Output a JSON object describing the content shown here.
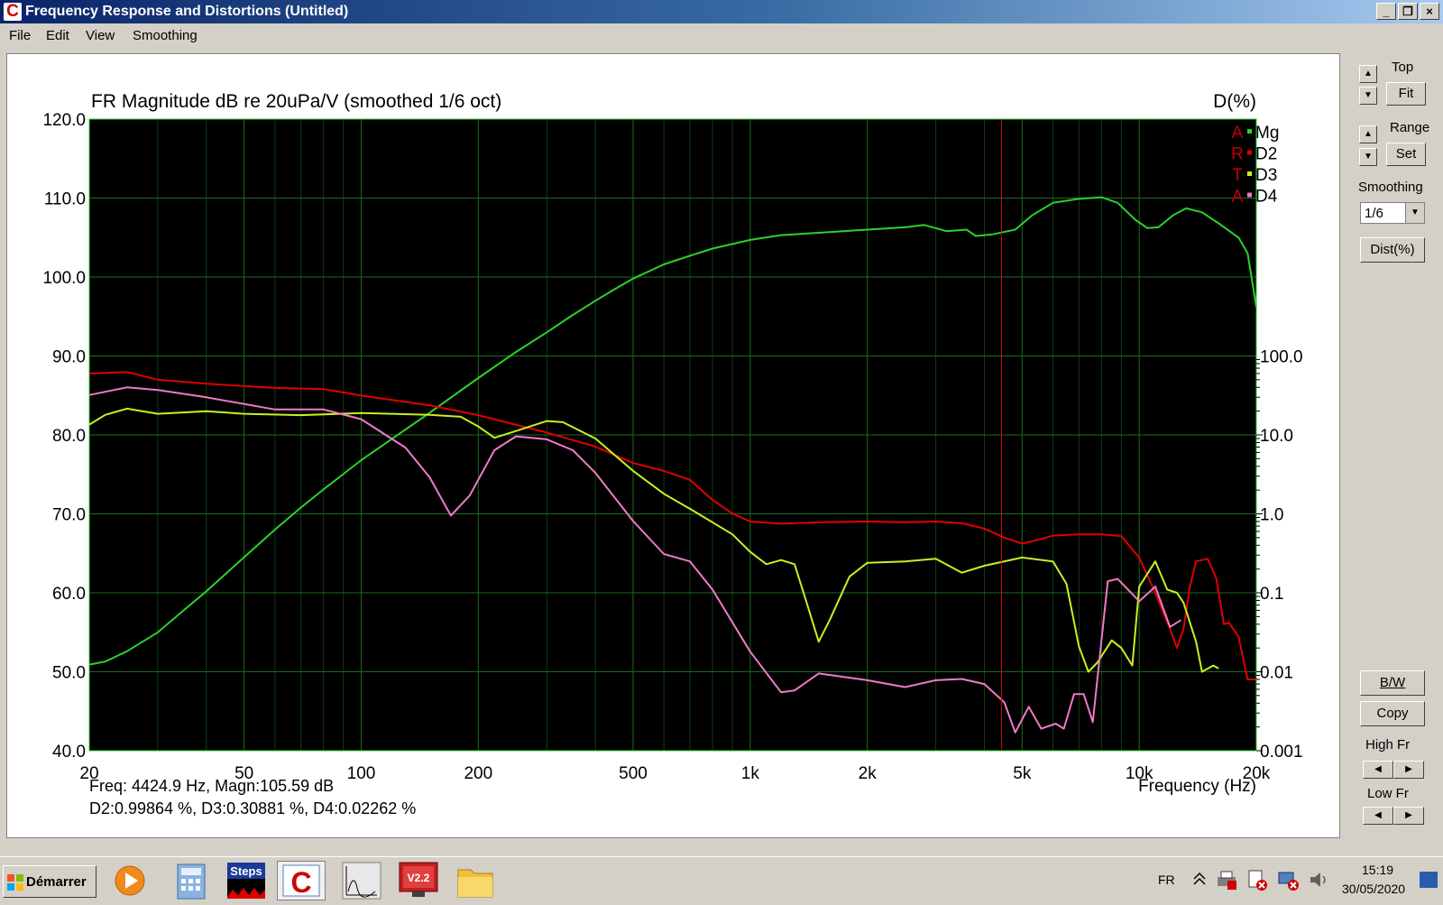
{
  "window": {
    "title": "Frequency Response and Distortions (Untitled)",
    "app_icon_glyph": "C",
    "controls": {
      "minimize": "_",
      "restore": "❐",
      "close": "×"
    }
  },
  "menu": {
    "items": [
      "File",
      "Edit",
      "View",
      "Smoothing"
    ]
  },
  "graph": {
    "title": "FR Magnitude dB re 20uPa/V (smoothed 1/6 oct)",
    "right_axis_title": "D(%)",
    "xlabel": "Frequency (Hz)",
    "rta_letters": [
      "A",
      "R",
      "T",
      "A"
    ],
    "legend": [
      {
        "name": "Mg",
        "color": "#2cd12c"
      },
      {
        "name": "D2",
        "color": "#e00000"
      },
      {
        "name": "D3",
        "color": "#c8f020"
      },
      {
        "name": "D4",
        "color": "#f07ac8"
      }
    ],
    "readout_line1": "Freq: 4424.9 Hz, Magn:105.59 dB",
    "readout_line2": "D2:0.99864 %, D3:0.30881 %, D4:0.02262 %"
  },
  "chart_data": {
    "type": "line",
    "title": "FR Magnitude dB re 20uPa/V (smoothed 1/6 oct)",
    "xlabel": "Frequency (Hz)",
    "ylabel": "",
    "y2label": "D(%)",
    "x_scale": "log",
    "y2_scale": "log",
    "xlim": [
      20,
      20000
    ],
    "ylim": [
      40,
      120
    ],
    "y2lim": [
      0.001,
      100
    ],
    "x_ticks": [
      20,
      50,
      100,
      200,
      500,
      1000,
      2000,
      5000,
      10000,
      20000
    ],
    "x_tick_labels": [
      "20",
      "50",
      "100",
      "200",
      "500",
      "1k",
      "2k",
      "5k",
      "10k",
      "20k"
    ],
    "y_ticks": [
      40,
      50,
      60,
      70,
      80,
      90,
      100,
      110,
      120
    ],
    "y_tick_labels": [
      "40.0",
      "50.0",
      "60.0",
      "70.0",
      "80.0",
      "90.0",
      "100.0",
      "110.0",
      "120.0"
    ],
    "y2_ticks": [
      0.001,
      0.01,
      0.1,
      1,
      10,
      100
    ],
    "y2_tick_labels": [
      "0.001",
      "0.01",
      "0.1",
      "1.0",
      "10.0",
      "100.0"
    ],
    "grid": true,
    "legend_position": "top-right",
    "background": "#000000",
    "cursor_x": 4424.9,
    "series": [
      {
        "name": "Mg",
        "axis": "left",
        "color": "#2cd12c",
        "points": [
          [
            20,
            50.9
          ],
          [
            22,
            51.3
          ],
          [
            25,
            52.6
          ],
          [
            30,
            55
          ],
          [
            35,
            57.8
          ],
          [
            40,
            60.2
          ],
          [
            50,
            64.5
          ],
          [
            60,
            68
          ],
          [
            70,
            70.8
          ],
          [
            80,
            73.1
          ],
          [
            100,
            76.8
          ],
          [
            120,
            79.5
          ],
          [
            150,
            82.8
          ],
          [
            180,
            85.6
          ],
          [
            200,
            87.2
          ],
          [
            250,
            90.5
          ],
          [
            300,
            93
          ],
          [
            350,
            95.2
          ],
          [
            400,
            97
          ],
          [
            450,
            98.5
          ],
          [
            500,
            99.8
          ],
          [
            600,
            101.6
          ],
          [
            700,
            102.7
          ],
          [
            800,
            103.6
          ],
          [
            1000,
            104.7
          ],
          [
            1200,
            105.3
          ],
          [
            1500,
            105.6
          ],
          [
            2000,
            106
          ],
          [
            2500,
            106.3
          ],
          [
            2800,
            106.6
          ],
          [
            3200,
            105.8
          ],
          [
            3600,
            106
          ],
          [
            3800,
            105.2
          ],
          [
            4200,
            105.4
          ],
          [
            4800,
            106
          ],
          [
            5300,
            107.8
          ],
          [
            6000,
            109.4
          ],
          [
            7000,
            109.9
          ],
          [
            8000,
            110.1
          ],
          [
            8800,
            109.4
          ],
          [
            9800,
            107.2
          ],
          [
            10500,
            106.2
          ],
          [
            11200,
            106.3
          ],
          [
            12200,
            107.8
          ],
          [
            13200,
            108.7
          ],
          [
            14500,
            108.2
          ],
          [
            16000,
            106.8
          ],
          [
            18000,
            105
          ],
          [
            19000,
            103
          ],
          [
            20000,
            96.2
          ]
        ]
      },
      {
        "name": "D2",
        "axis": "right",
        "color": "#e00000",
        "points": [
          [
            20,
            59.8
          ],
          [
            25,
            62.4
          ],
          [
            30,
            50
          ],
          [
            40,
            44.5
          ],
          [
            60,
            39.4
          ],
          [
            80,
            38.1
          ],
          [
            100,
            31.5
          ],
          [
            150,
            23.7
          ],
          [
            200,
            17.8
          ],
          [
            300,
            10.7
          ],
          [
            400,
            7.1
          ],
          [
            500,
            4.4
          ],
          [
            600,
            3.5
          ],
          [
            700,
            2.7
          ],
          [
            800,
            1.5
          ],
          [
            900,
            1.01
          ],
          [
            1000,
            0.8
          ],
          [
            1200,
            0.75
          ],
          [
            1500,
            0.78
          ],
          [
            2000,
            0.8
          ],
          [
            2500,
            0.78
          ],
          [
            3000,
            0.8
          ],
          [
            3500,
            0.76
          ],
          [
            4000,
            0.65
          ],
          [
            4500,
            0.5
          ],
          [
            5000,
            0.42
          ],
          [
            5500,
            0.47
          ],
          [
            6000,
            0.53
          ],
          [
            7000,
            0.55
          ],
          [
            8000,
            0.55
          ],
          [
            9000,
            0.52
          ],
          [
            10000,
            0.28
          ],
          [
            11000,
            0.1
          ],
          [
            12000,
            0.035
          ],
          [
            12500,
            0.02
          ],
          [
            13000,
            0.035
          ],
          [
            13500,
            0.12
          ],
          [
            14000,
            0.25
          ],
          [
            15000,
            0.27
          ],
          [
            15800,
            0.15
          ],
          [
            16500,
            0.04
          ],
          [
            17000,
            0.042
          ],
          [
            18000,
            0.028
          ],
          [
            19000,
            0.008
          ],
          [
            20000,
            0.008
          ]
        ]
      },
      {
        "name": "D3",
        "axis": "right",
        "color": "#c8f020",
        "points": [
          [
            20,
            13.5
          ],
          [
            22,
            18
          ],
          [
            25,
            21.5
          ],
          [
            30,
            18.5
          ],
          [
            40,
            20
          ],
          [
            50,
            18.5
          ],
          [
            70,
            17.8
          ],
          [
            100,
            18.9
          ],
          [
            150,
            18
          ],
          [
            180,
            17
          ],
          [
            200,
            12.8
          ],
          [
            220,
            9.2
          ],
          [
            250,
            11.2
          ],
          [
            300,
            15
          ],
          [
            330,
            14.5
          ],
          [
            400,
            9
          ],
          [
            500,
            3.5
          ],
          [
            600,
            1.8
          ],
          [
            700,
            1.16
          ],
          [
            800,
            0.78
          ],
          [
            900,
            0.55
          ],
          [
            1000,
            0.33
          ],
          [
            1100,
            0.23
          ],
          [
            1200,
            0.26
          ],
          [
            1300,
            0.23
          ],
          [
            1400,
            0.072
          ],
          [
            1500,
            0.024
          ],
          [
            1600,
            0.045
          ],
          [
            1800,
            0.16
          ],
          [
            2000,
            0.24
          ],
          [
            2500,
            0.25
          ],
          [
            3000,
            0.27
          ],
          [
            3500,
            0.18
          ],
          [
            4000,
            0.22
          ],
          [
            5000,
            0.28
          ],
          [
            6000,
            0.25
          ],
          [
            6500,
            0.13
          ],
          [
            7000,
            0.021
          ],
          [
            7400,
            0.01
          ],
          [
            7800,
            0.013
          ],
          [
            8500,
            0.025
          ],
          [
            9000,
            0.02
          ],
          [
            9600,
            0.012
          ],
          [
            10000,
            0.12
          ],
          [
            11000,
            0.25
          ],
          [
            11800,
            0.11
          ],
          [
            12500,
            0.1
          ],
          [
            13000,
            0.075
          ],
          [
            14000,
            0.024
          ],
          [
            14500,
            0.01
          ],
          [
            15500,
            0.012
          ],
          [
            16000,
            0.011
          ]
        ]
      },
      {
        "name": "D4",
        "axis": "right",
        "color": "#f07ac8",
        "points": [
          [
            20,
            32
          ],
          [
            25,
            40
          ],
          [
            30,
            37
          ],
          [
            40,
            30
          ],
          [
            60,
            21
          ],
          [
            80,
            21
          ],
          [
            100,
            15.8
          ],
          [
            130,
            6.9
          ],
          [
            150,
            2.9
          ],
          [
            170,
            0.95
          ],
          [
            190,
            1.7
          ],
          [
            220,
            6.4
          ],
          [
            250,
            9.6
          ],
          [
            300,
            8.8
          ],
          [
            350,
            6.4
          ],
          [
            400,
            3.3
          ],
          [
            500,
            0.81
          ],
          [
            600,
            0.31
          ],
          [
            700,
            0.25
          ],
          [
            800,
            0.11
          ],
          [
            1000,
            0.018
          ],
          [
            1200,
            0.0055
          ],
          [
            1300,
            0.0058
          ],
          [
            1500,
            0.0095
          ],
          [
            2000,
            0.0078
          ],
          [
            2500,
            0.0064
          ],
          [
            3000,
            0.0078
          ],
          [
            3500,
            0.0081
          ],
          [
            4000,
            0.007
          ],
          [
            4500,
            0.0041
          ],
          [
            4800,
            0.0017
          ],
          [
            5200,
            0.0036
          ],
          [
            5600,
            0.0019
          ],
          [
            6100,
            0.0022
          ],
          [
            6400,
            0.0019
          ],
          [
            6800,
            0.0052
          ],
          [
            7200,
            0.0052
          ],
          [
            7600,
            0.0023
          ],
          [
            8300,
            0.14
          ],
          [
            8800,
            0.15
          ],
          [
            9200,
            0.12
          ],
          [
            10000,
            0.078
          ],
          [
            11000,
            0.12
          ],
          [
            12000,
            0.037
          ],
          [
            12800,
            0.045
          ]
        ]
      }
    ]
  },
  "controls": {
    "top_label": "Top",
    "fit_button": "Fit",
    "range_label": "Range",
    "set_button": "Set",
    "smoothing_label": "Smoothing",
    "smoothing_value": "1/6",
    "dist_button": "Dist(%)",
    "bw_button": "B/W",
    "copy_button": "Copy",
    "high_fr_label": "High Fr",
    "low_fr_label": "Low Fr",
    "arrow_up": "▲",
    "arrow_down": "▼",
    "arrow_left": "◀",
    "arrow_right": "▶"
  },
  "taskbar": {
    "start_label": "Démarrer",
    "steps_label": "Steps",
    "v22_label": "V2.2",
    "language": "FR",
    "time": "15:19",
    "date": "30/05/2020"
  }
}
